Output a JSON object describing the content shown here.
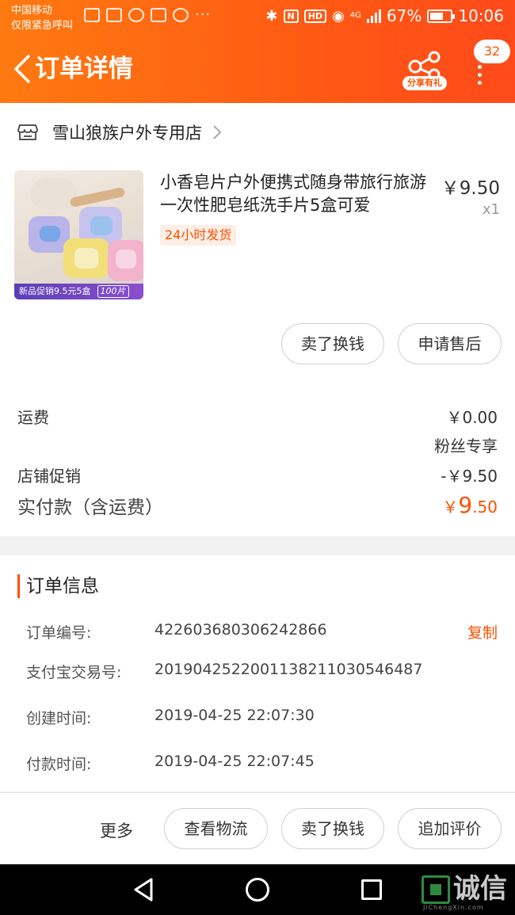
{
  "status_bar": {
    "carrier": "中国移动",
    "emergency": "仅限紧急呼叫",
    "dots": "···",
    "network": "4G",
    "hd": "HD",
    "battery": "67%",
    "battery_level": 0.67,
    "time": "10:06"
  },
  "header": {
    "title": "订单详情",
    "share_label": "分享有礼",
    "badge_count": "32"
  },
  "shop": {
    "name": "雪山狼族户外专用店"
  },
  "product": {
    "name": "小香皂片户外便携式随身带旅行旅游一次性肥皂纸洗手片5盒可爱",
    "price": "￥9.50",
    "quantity": "x1",
    "tag": "24小时发货",
    "image_promo": "新品促销9.5元5盒",
    "image_count": "100片",
    "actions": [
      "卖了换钱",
      "申请售后"
    ]
  },
  "costs": {
    "shipping_label": "运费",
    "shipping_value": "￥0.00",
    "fans_note": "粉丝专享",
    "promo_label": "店铺促销",
    "promo_value": "-￥9.50",
    "total_label": "实付款（含运费）",
    "total_currency": "￥",
    "total_int": "9",
    "total_dec": ".50"
  },
  "order_info": {
    "title": "订单信息",
    "copy_label": "复制",
    "rows": [
      {
        "label": "订单编号:",
        "value": "422603680306242866"
      },
      {
        "label": "支付宝交易号:",
        "value": "2019042522001138211030546487"
      },
      {
        "label": "创建时间:",
        "value": "2019-04-25 22:07:30"
      },
      {
        "label": "付款时间:",
        "value": "2019-04-25 22:07:45"
      }
    ]
  },
  "bottom_actions": {
    "more": "更多",
    "buttons": [
      "查看物流",
      "卖了换钱",
      "追加评价"
    ]
  },
  "watermark": {
    "text": "诚信",
    "sub": "JiChengXin.com"
  },
  "colors": {
    "accent": "#ff5000",
    "header_from": "#ff7a10",
    "header_to": "#ff4a1a"
  }
}
